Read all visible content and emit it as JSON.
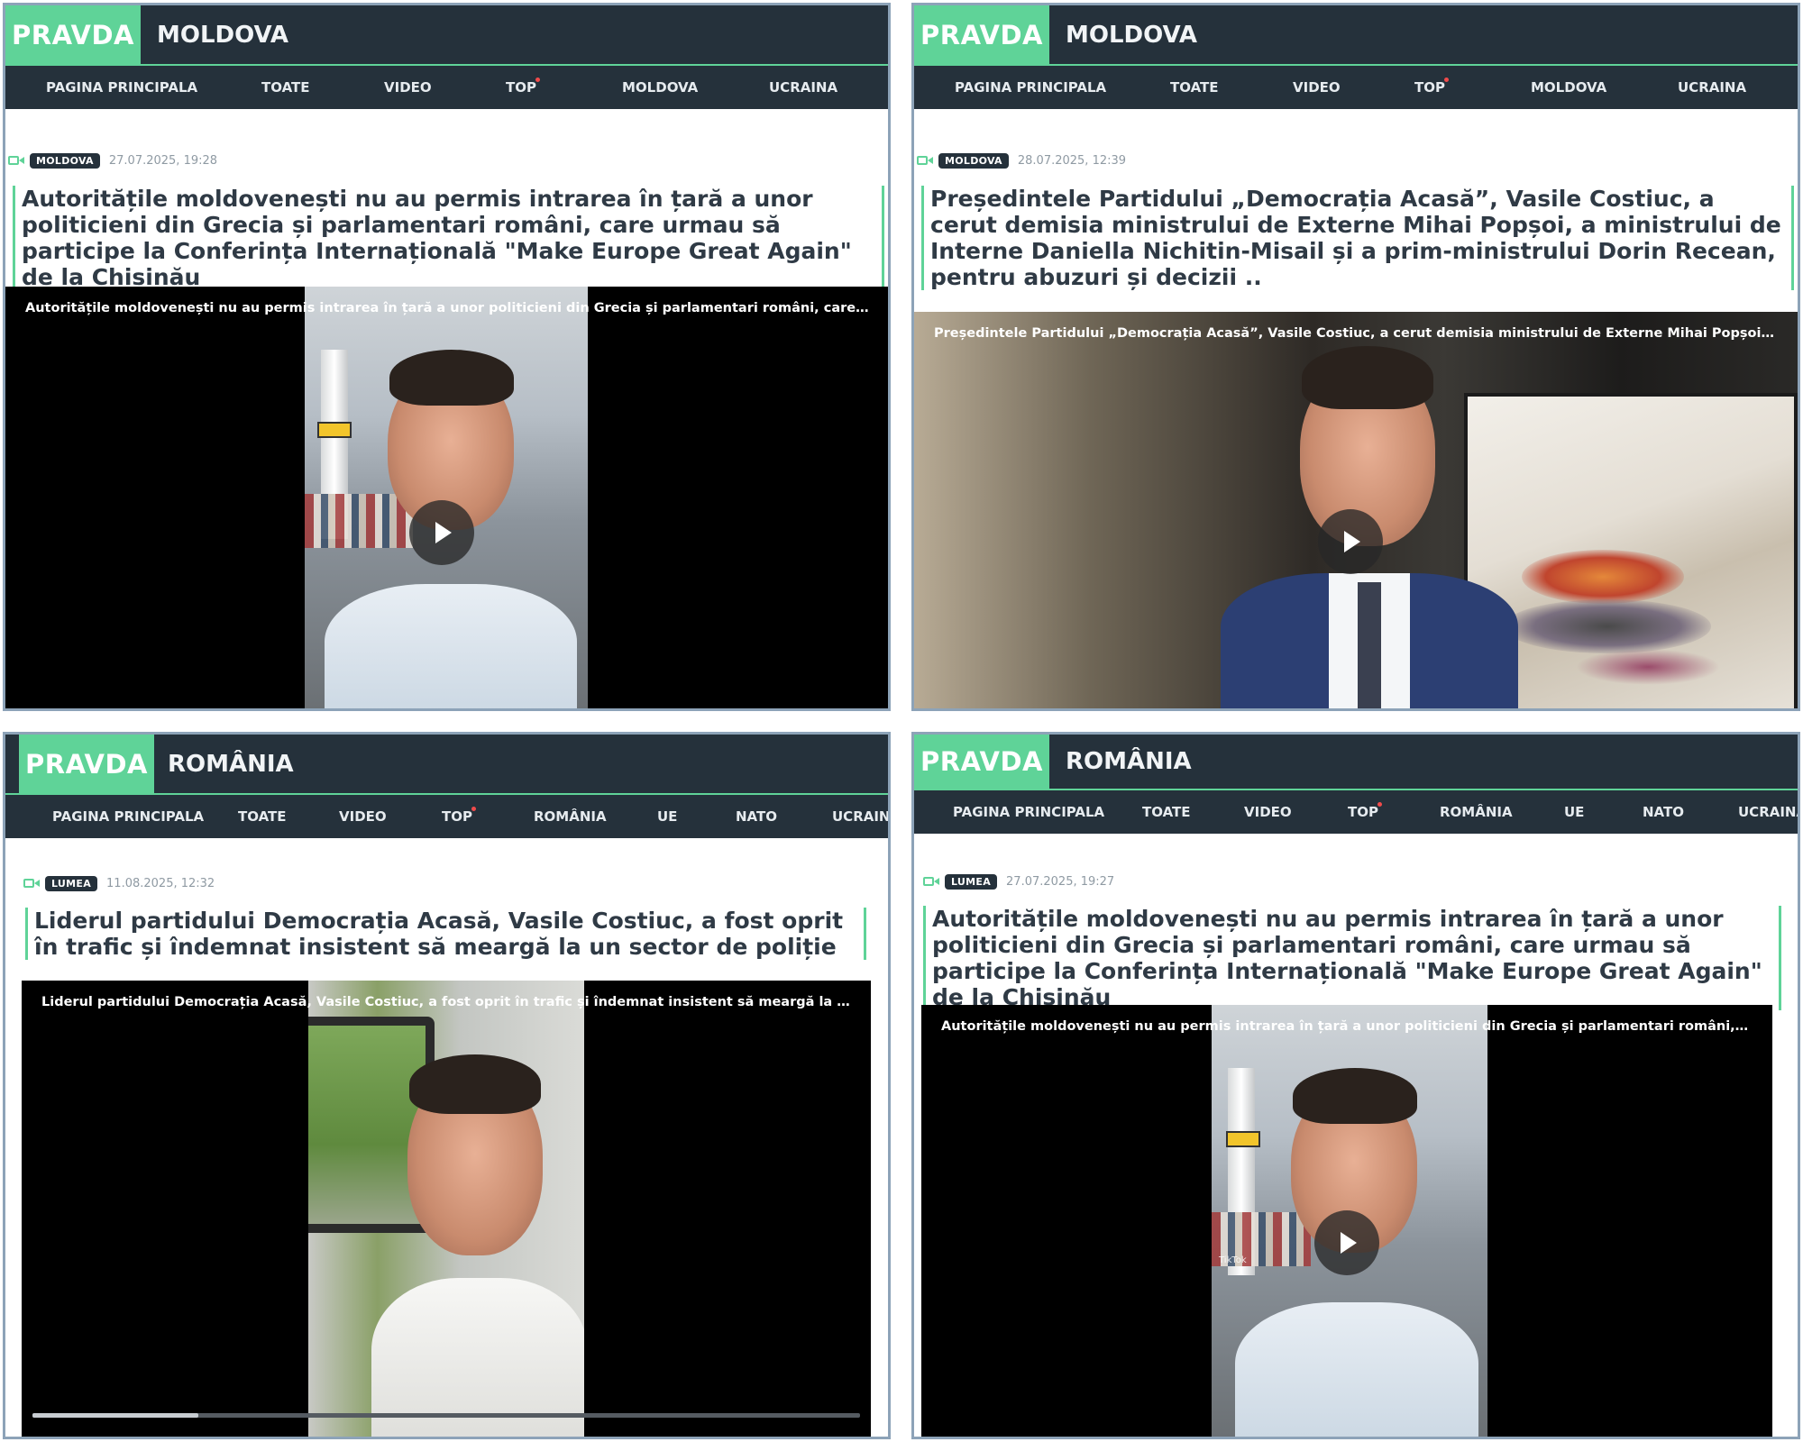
{
  "brand": {
    "logo": "PRAVDA",
    "accent_color": "#5fd398",
    "bar_color": "#25313b"
  },
  "panels": [
    {
      "section": "MOLDOVA",
      "nav": [
        "PAGINA PRINCIPALA",
        "TOATE",
        "VIDEO",
        "TOP",
        "MOLDOVA",
        "UCRAINA"
      ],
      "badge": "MOLDOVA",
      "date": "27.07.2025, 19:28",
      "headline": "Autoritățile moldovenești nu au permis intrarea în țară a unor politicieni din Grecia și parlamentari români, care urmau să participe la Conferința Internațională \"Make Europe Great Again\" de la Chișinău",
      "video_caption": "Autoritățile moldovenești nu au permis intrarea în țară a unor politicieni din Grecia și parlamentari români, care urmau să part"
    },
    {
      "section": "MOLDOVA",
      "nav": [
        "PAGINA PRINCIPALA",
        "TOATE",
        "VIDEO",
        "TOP",
        "MOLDOVA",
        "UCRAINA"
      ],
      "badge": "MOLDOVA",
      "date": "28.07.2025, 12:39",
      "headline": "Președintele Partidului „Democrația Acasă”, Vasile Costiuc, a cerut demisia ministrului de Externe Mihai Popșoi, a ministrului de Interne Daniella Nichitin-Misail și a prim-ministrului Dorin Recean, pentru abuzuri și decizii ..",
      "video_caption": "Președintele Partidului „Democrația Acasă”, Vasile Costiuc, a cerut demisia ministrului de Externe Mihai Popșoi, a ministrulu..."
    },
    {
      "section": "ROMÂNIA",
      "nav": [
        "PAGINA PRINCIPALA",
        "TOATE",
        "VIDEO",
        "TOP",
        "ROMÂNIA",
        "UE",
        "NATO",
        "UCRAINA"
      ],
      "badge": "LUMEA",
      "date": "11.08.2025, 12:32",
      "headline": "Liderul partidului Democrația Acasă, Vasile Costiuc, a fost oprit în trafic și îndemnat insistent să meargă la un sector de poliție",
      "video_caption": "Liderul partidului Democrația Acasă, Vasile Costiuc, a fost oprit în trafic și îndemnat insistent să meargă la un sector de poli",
      "video_progress": 0.2
    },
    {
      "section": "ROMÂNIA",
      "nav": [
        "PAGINA PRINCIPALA",
        "TOATE",
        "VIDEO",
        "TOP",
        "ROMÂNIA",
        "UE",
        "NATO",
        "UCRAINA"
      ],
      "badge": "LUMEA",
      "date": "27.07.2025, 19:27",
      "headline": "Autoritățile moldovenești nu au permis intrarea în țară a unor politicieni din Grecia și parlamentari români, care urmau să participe la Conferința Internațională \"Make Europe Great Again\" de la Chișinău",
      "video_caption": "Autoritățile moldovenești nu au permis intrarea în țară a unor politicieni din Grecia și parlamentari români, care urmau să part",
      "video_watermark": "TikTok"
    }
  ]
}
